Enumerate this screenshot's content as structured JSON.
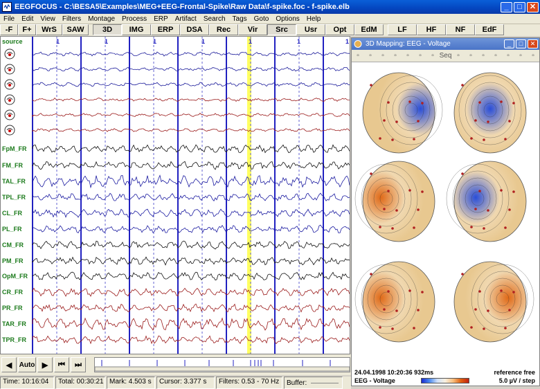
{
  "window": {
    "title": "EEGFOCUS  -  C:\\BESA5\\Examples\\MEG+EEG-Frontal-Spike\\Raw Data\\f-spike.foc  -  f-spike.elb",
    "minimize": "_",
    "maximize": "□",
    "close": "✕"
  },
  "menu": [
    "File",
    "Edit",
    "View",
    "Filters",
    "Montage",
    "Process",
    "ERP",
    "Artifact",
    "Search",
    "Tags",
    "Goto",
    "Options",
    "Help"
  ],
  "toolbar": [
    "-F",
    "F+",
    "WrS",
    "SAW",
    "3D",
    "IMG",
    "ERP",
    "DSA",
    "Rec",
    "Vir",
    "Src",
    "Usr",
    "Opt",
    "EdM",
    "LF",
    "HF",
    "NF",
    "EdF"
  ],
  "toolbar_pressed": [
    "3D",
    "Src"
  ],
  "eeg": {
    "source_label": "source",
    "channels": [
      "FpM_FR",
      "FM_FR",
      "TAL_FR",
      "TPL_FR",
      "CL_FR",
      "PL_FR",
      "CM_FR",
      "PM_FR",
      "OpM_FR",
      "CR_FR",
      "PR_FR",
      "TAR_FR",
      "TPR_FR"
    ],
    "tick_marks": [
      "1",
      "1",
      "1",
      "1",
      "1",
      "1",
      "1",
      "1"
    ],
    "highlight_color": "#ffff60",
    "trace_colors": {
      "source": "#1a1a9a",
      "red": "#9a1a1a",
      "black": "#111111",
      "blue": "#1a1aa0"
    }
  },
  "panel": {
    "title": "3D Mapping: EEG - Voltage",
    "toolbar_icons": [
      "move-icon",
      "zoom-icon",
      "pan-icon",
      "rotate-left-icon",
      "rotate-icon",
      "rotate-right-icon",
      "rotate-down-icon",
      "seq-icon",
      "grid-icon",
      "camera-icon",
      "arrows-icon",
      "export-icon",
      "split-icon",
      "color-icon",
      "settings-icon"
    ],
    "seq_label": "Seq",
    "datetime": "24.04.1998  10:20:36 932ms",
    "reference": "reference free",
    "measure": "EEG - Voltage",
    "scale": "5.0 µV / step",
    "colors": {
      "positive": "#e06a18",
      "negative": "#2a4ed8",
      "neutral": "#f4e4c8"
    }
  },
  "bottom": {
    "auto_label": "Auto",
    "prev_icon": "◀",
    "next_icon": "▶",
    "skip_back_icon": "⏮",
    "skip_fwd_icon": "⏭"
  },
  "status": {
    "time": "Time: 10:16:04",
    "total": "Total: 00:30:21",
    "mark": "Mark: 4.503 s",
    "cursor": "Cursor: 3.377 s",
    "filters": "Filters: 0.53 - 70 Hz",
    "buffer": "Buffer:"
  }
}
